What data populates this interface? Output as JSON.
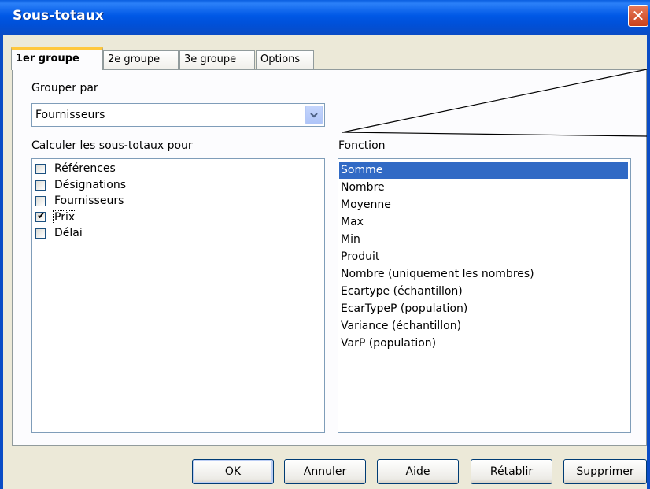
{
  "window": {
    "title": "Sous-totaux",
    "close_glyph": "✕"
  },
  "tabs": [
    {
      "label": "1er groupe",
      "active": true
    },
    {
      "label": "2e groupe",
      "active": false
    },
    {
      "label": "3e groupe",
      "active": false
    },
    {
      "label": "Options",
      "active": false
    }
  ],
  "group_by": {
    "label": "Grouper par",
    "value": "Fournisseurs"
  },
  "subtotals": {
    "label": "Calculer les sous-totaux pour",
    "fields": [
      {
        "label": "Références",
        "checked": false
      },
      {
        "label": "Désignations",
        "checked": false
      },
      {
        "label": "Fournisseurs",
        "checked": false
      },
      {
        "label": "Prix",
        "checked": true
      },
      {
        "label": "Délai",
        "checked": false
      }
    ]
  },
  "function": {
    "label": "Fonction",
    "items": [
      "Somme",
      "Nombre",
      "Moyenne",
      "Max",
      "Min",
      "Produit",
      "Nombre (uniquement les nombres)",
      "Ecartype (échantillon)",
      "EcarTypeP (population)",
      "Variance (échantillon)",
      "VarP (population)"
    ],
    "selected": "Somme"
  },
  "buttons": {
    "ok": "OK",
    "cancel": "Annuler",
    "help": "Aide",
    "reset": "Rétablir",
    "delete": "Supprimer"
  },
  "colors": {
    "titlebar": "#0058e6",
    "selection": "#316ac5",
    "active_tab_accent": "#ffc73c",
    "dialog_bg": "#ece9d8"
  }
}
